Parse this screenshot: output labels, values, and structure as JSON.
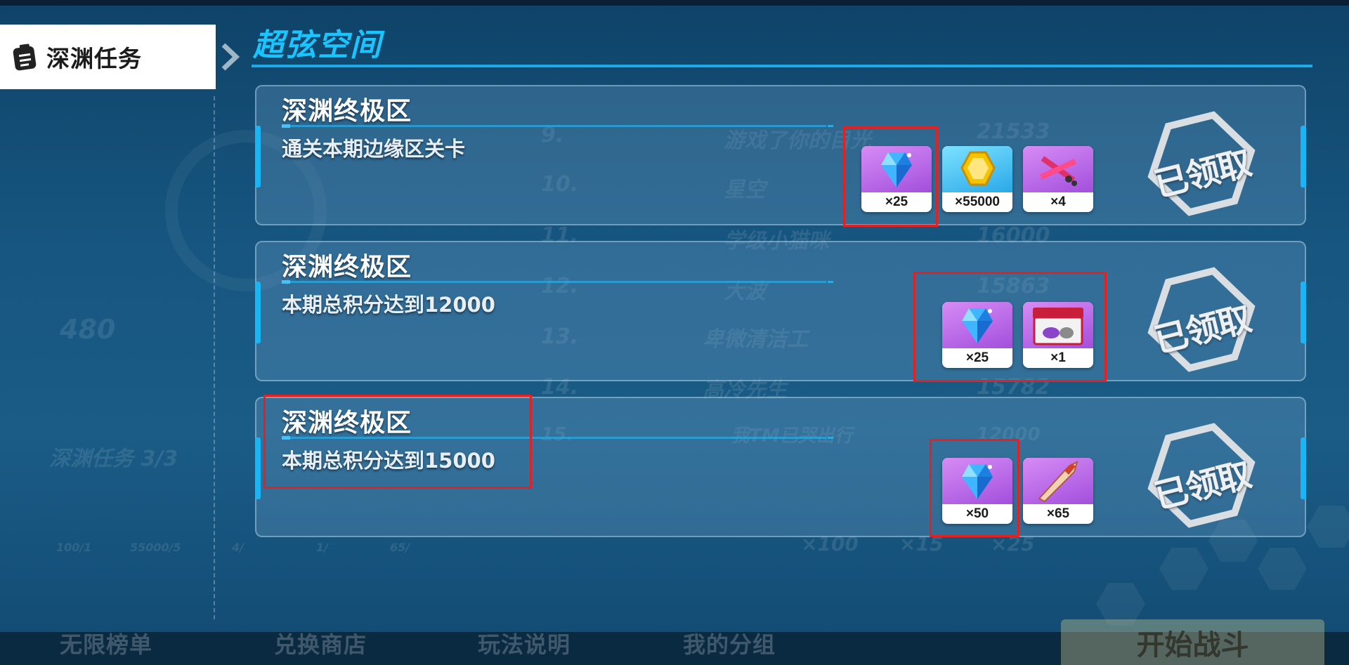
{
  "sidebar": {
    "tab_label": "深渊任务",
    "tab_icon": "clipboard-icon"
  },
  "header": {
    "title": "超弦空间"
  },
  "tasks": [
    {
      "title": "深渊终极区",
      "description": "通关本期边缘区关卡",
      "status": "已领取",
      "rewards": [
        {
          "icon": "crystal-icon",
          "quantity": "×25"
        },
        {
          "icon": "gold-coin-icon",
          "quantity": "×55000"
        },
        {
          "icon": "weapon-parts-icon",
          "quantity": "×4"
        }
      ]
    },
    {
      "title": "深渊终极区",
      "description": "本期总积分达到12000",
      "status": "已领取",
      "rewards": [
        {
          "icon": "crystal-icon",
          "quantity": "×25"
        },
        {
          "icon": "supply-box-icon",
          "quantity": "×1"
        }
      ]
    },
    {
      "title": "深渊终极区",
      "description": "本期总积分达到15000",
      "status": "已领取",
      "rewards": [
        {
          "icon": "crystal-icon",
          "quantity": "×50"
        },
        {
          "icon": "blade-fragment-icon",
          "quantity": "×65"
        }
      ]
    }
  ],
  "background_faded": {
    "rank_rows": [
      {
        "rank": "9.",
        "name": "游戏了你的目光",
        "score": "21533"
      },
      {
        "rank": "10.",
        "name": "星空",
        "score": ""
      },
      {
        "rank": "11.",
        "name": "学级小猫咪",
        "score": "16000"
      },
      {
        "rank": "12.",
        "name": "大波",
        "score": "15863"
      },
      {
        "rank": "13.",
        "name": "卑微清洁工",
        "score": ""
      },
      {
        "rank": "14.",
        "name": "高冷先生",
        "score": "15782"
      },
      {
        "rank": "15.",
        "name": "我TM已哭出行",
        "score": "12000"
      }
    ],
    "left_score": "480",
    "left_task_progress": "深渊任务 3/3",
    "small_values": [
      "100/1",
      "55000/5",
      "4/",
      "1/",
      "65/"
    ],
    "bottom_counts": [
      "×100",
      "×15",
      "×25"
    ]
  },
  "bottom_nav": {
    "items": [
      "无限榜单",
      "兑换商店",
      "玩法说明",
      "我的分组"
    ],
    "start_button": "开始战斗"
  },
  "colors": {
    "accent_cyan": "#19c4ff",
    "highlight_red": "#e42020",
    "card_border": "#bedcf0"
  }
}
